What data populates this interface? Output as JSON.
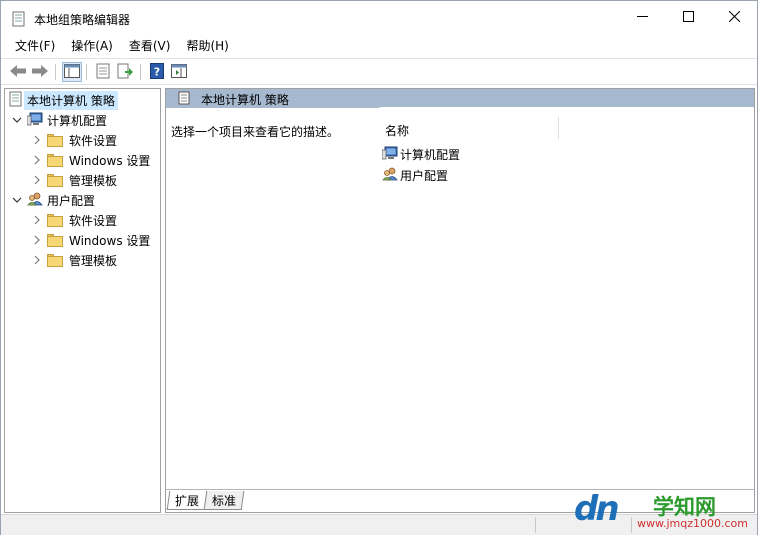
{
  "window": {
    "title": "本地组策略编辑器",
    "icons": {
      "app": "policy-document-icon",
      "minimize": "minimize-icon",
      "maximize": "maximize-icon",
      "close": "close-icon"
    }
  },
  "menu": [
    "文件(F)",
    "操作(A)",
    "查看(V)",
    "帮助(H)"
  ],
  "toolbar": {
    "buttons": [
      "back-arrow-icon",
      "forward-arrow-icon",
      "show-hide-tree-icon",
      "properties-icon",
      "export-list-icon",
      "help-icon",
      "show-hide-action-pane-icon"
    ]
  },
  "tree": {
    "root": "本地计算机 策略",
    "computer_config": "计算机配置",
    "user_config": "用户配置",
    "software_settings": "软件设置",
    "windows_settings": "Windows 设置",
    "admin_templates": "管理模板"
  },
  "detail": {
    "header_title": "本地计算机 策略",
    "description": "选择一个项目来查看它的描述。",
    "column_name": "名称",
    "items": [
      "计算机配置",
      "用户配置"
    ]
  },
  "tabs": {
    "extended": "扩展",
    "standard": "标准"
  },
  "watermark": {
    "logo": "dn",
    "name": "学知网",
    "url": "www.jmqz1000.com"
  },
  "colors": {
    "header_bar": "#a6b9cf",
    "selection": "#cce8ff",
    "folder": "#f6d776"
  }
}
